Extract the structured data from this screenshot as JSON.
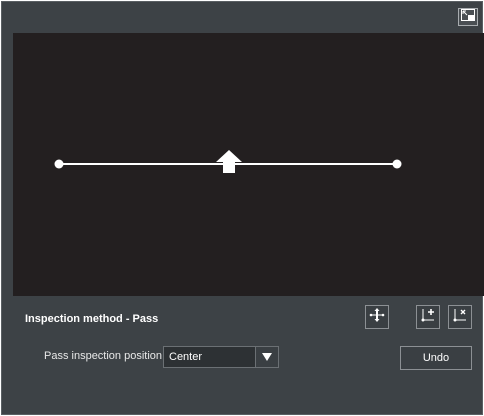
{
  "icons": {
    "maximize": "maximize-icon",
    "move": "move-line-icon",
    "add_point": "add-point-icon",
    "delete_point": "delete-point-icon",
    "dropdown": "chevron-down-icon"
  },
  "section": {
    "title": "Inspection method - Pass"
  },
  "form": {
    "position_label": "Pass inspection position",
    "position_value": "Center",
    "undo_label": "Undo"
  },
  "colors": {
    "panel_bg": "#3d4246",
    "canvas_bg": "#231f20",
    "line": "#ffffff"
  }
}
